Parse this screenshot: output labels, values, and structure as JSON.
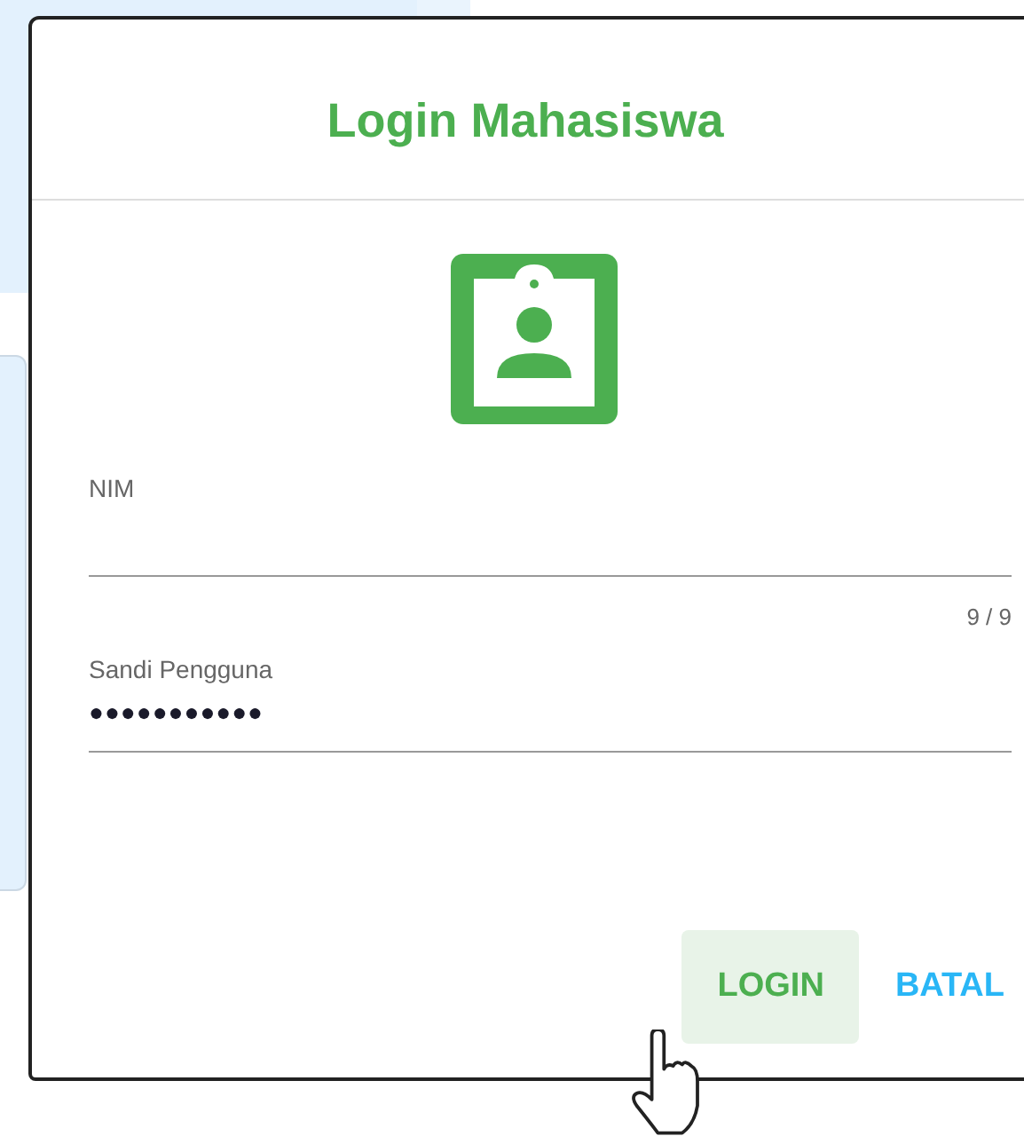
{
  "dialog": {
    "title": "Login Mahasiswa",
    "fields": [
      {
        "kind": "text",
        "label": "NIM",
        "counter": "9 / 9"
      },
      {
        "kind": "password",
        "label": "Sandi Pengguna",
        "value": "●●●●●●●●●●●"
      }
    ],
    "buttons": [
      {
        "label": "LOGIN",
        "kind": "primary",
        "hovered": true
      },
      {
        "label": "BATAL",
        "kind": "secondary",
        "hovered": false
      }
    ]
  }
}
